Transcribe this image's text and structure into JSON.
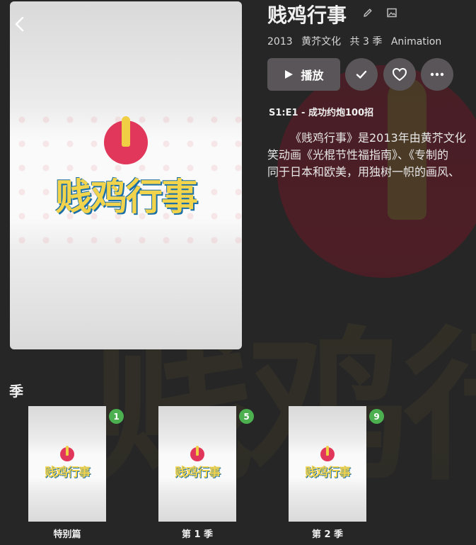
{
  "header": {
    "title": "贱鸡行事",
    "meta": [
      "2013",
      "黄芥文化",
      "共 3 季",
      "Animation"
    ]
  },
  "poster": {
    "logo_text": "贱鸡行事"
  },
  "actions": {
    "play_label": "播放"
  },
  "episode": {
    "next_up": "S1:E1 - 成功约炮100招"
  },
  "overview": {
    "lines": [
      "《贱鸡行事》是2013年由黄芥文化",
      "笑动画《光棍节性福指南》、《专制的",
      "同于日本和欧美，用独树一帜的画风、"
    ]
  },
  "seasons": {
    "heading": "季",
    "items": [
      {
        "label": "特别篇",
        "count": "1",
        "logo_text": "贱鸡行事"
      },
      {
        "label": "第 1 季",
        "count": "5",
        "logo_text": "贱鸡行事"
      },
      {
        "label": "第 2 季",
        "count": "9",
        "logo_text": "贱鸡行事"
      }
    ]
  },
  "colors": {
    "background": "#262626",
    "button_bg": "#5a5558",
    "badge_green": "#4caf50",
    "logo_red": "#e0375a",
    "logo_yellow": "#f2d34c",
    "logo_blue": "#1b6fa8"
  },
  "icons": [
    "chevron-left-icon",
    "pencil-icon",
    "image-icon",
    "play-icon",
    "check-icon",
    "heart-icon",
    "more-icon"
  ]
}
